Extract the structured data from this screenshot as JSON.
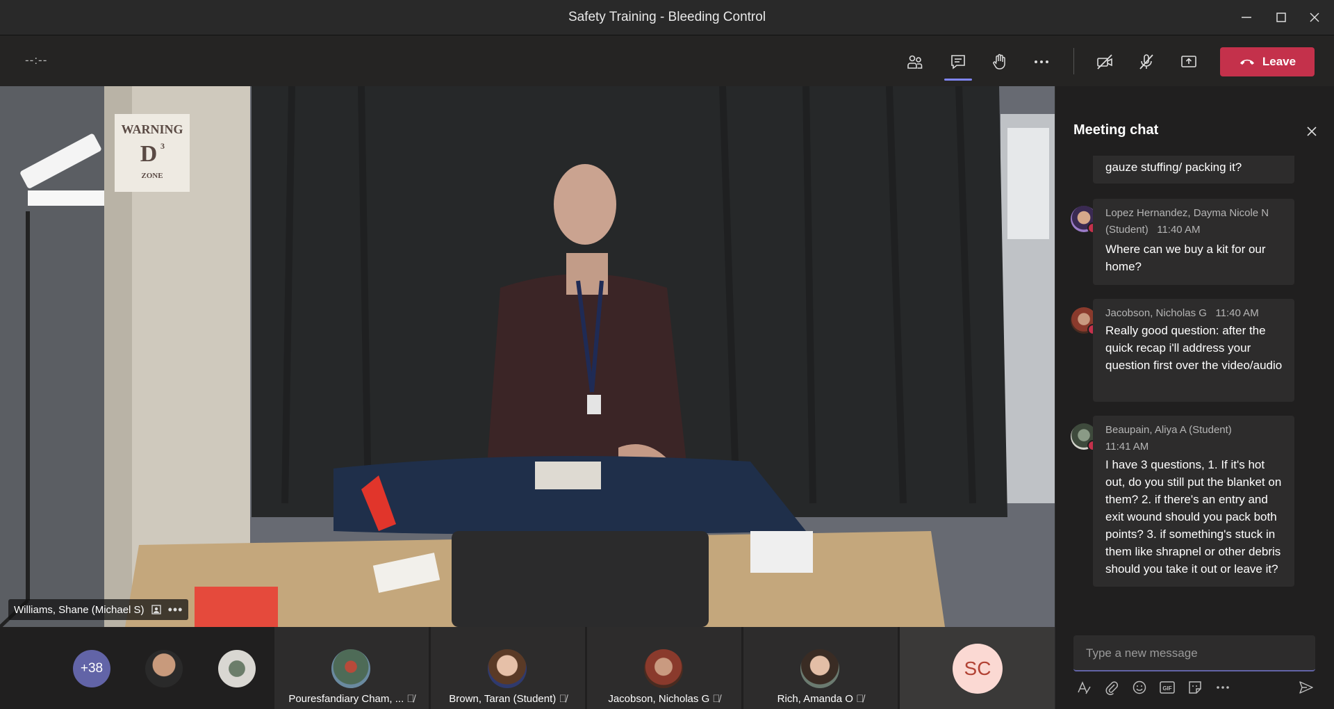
{
  "window": {
    "title": "Safety Training - Bleeding Control"
  },
  "toolbar": {
    "timer": "--:--",
    "leave_label": "Leave"
  },
  "video": {
    "speaker_name": "Williams, Shane (Michael S)",
    "poster_text": [
      "WARNING",
      "D",
      "3",
      "ZONE"
    ]
  },
  "participants": {
    "overflow_count": "+38",
    "tiles": [
      {
        "name": "Pouresfandiary Cham, ..."
      },
      {
        "name": "Brown, Taran (Student)"
      },
      {
        "name": "Jacobson, Nicholas G"
      },
      {
        "name": "Rich, Amanda O"
      }
    ],
    "self_initials": "SC"
  },
  "chat": {
    "title": "Meeting chat",
    "messages": [
      {
        "author": "",
        "time": "",
        "text": "gauze stuffing/ packing it?"
      },
      {
        "author": "Lopez Hernandez, Dayma Nicole N (Student)",
        "time": "11:40 AM",
        "text": "Where can we buy a kit for our home?"
      },
      {
        "author": "Jacobson, Nicholas G",
        "time": "11:40 AM",
        "text": "Really good question: after the quick recap i'll address your question first over the video/audio"
      },
      {
        "author": "Beaupain, Aliya A (Student)",
        "time": "11:41 AM",
        "text": "I have 3 questions, 1. If it's hot out, do you still put the blanket on them? 2. if there's an entry and exit wound should you pack both points? 3. if something's stuck in them like shrapnel or other debris should you take it out or leave it?"
      }
    ],
    "compose_placeholder": "Type a new message"
  },
  "colors": {
    "leave": "#c4314b",
    "accent": "#6264a7",
    "overflow_badge": "#6264a7",
    "self_avatar": "#fbd9d3"
  }
}
